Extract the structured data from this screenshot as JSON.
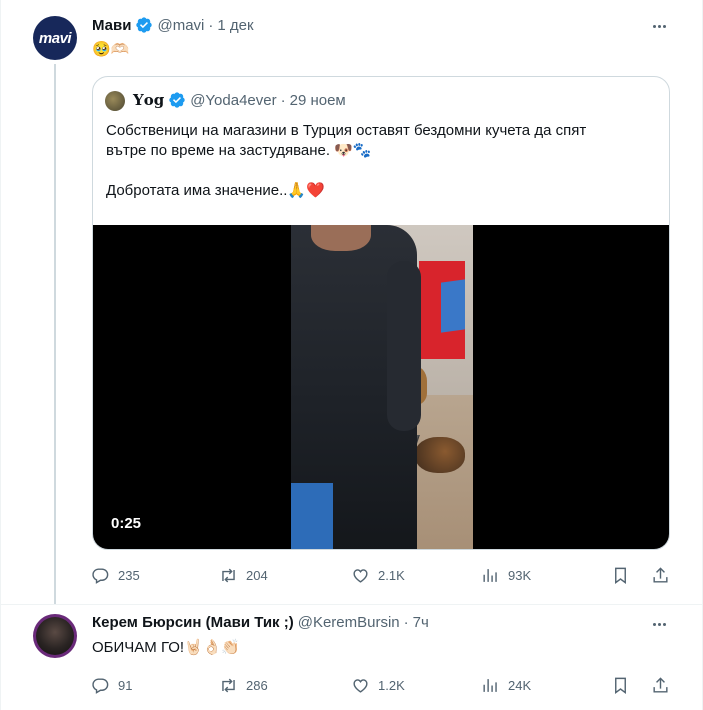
{
  "tweet1": {
    "display_name": "Мави",
    "handle": "@mavi",
    "separator": "·",
    "time": "1 дек",
    "avatar_text": "mavi",
    "text": "🥹🫶🏻",
    "quote": {
      "display_name": "𝐘𝐨𝐠",
      "handle": "@Yoda4ever",
      "separator": "·",
      "time": "29 ноем",
      "text_line1": "Собственици на магазини в Турция оставят бездомни кучета да спят",
      "text_line2": "вътре по време на застудяване. 🐶🐾",
      "text_line3": "Добротата има значение..🙏❤️",
      "video_duration": "0:25"
    },
    "stats": {
      "replies": "235",
      "reposts": "204",
      "likes": "2.1K",
      "views": "93K"
    }
  },
  "tweet2": {
    "display_name": "Керем Бюрсин (Мави Тик ;)",
    "handle": "@KeremBursin",
    "separator": "·",
    "time": "7ч",
    "text": "ОБИЧАМ ГО!🤘🏻👌🏻👏🏻",
    "stats": {
      "replies": "91",
      "reposts": "286",
      "likes": "1.2K",
      "views": "24K"
    }
  },
  "colors": {
    "verified_blue": "#1d9bf0",
    "muted_text": "#536471",
    "mavi_brand": "#17285a"
  },
  "icons": [
    "verified-badge-icon",
    "more-icon",
    "reply-icon",
    "repost-icon",
    "like-icon",
    "views-icon",
    "bookmark-icon",
    "share-icon"
  ]
}
